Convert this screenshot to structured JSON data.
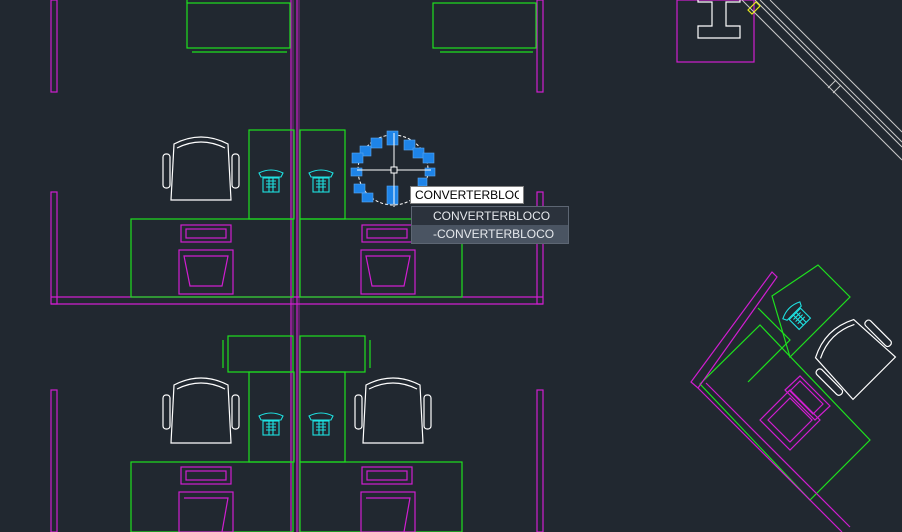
{
  "drawing": {
    "background": "#212830",
    "colors": {
      "partition": "#d01ed0",
      "furniture": "#1ee11e",
      "chair": "#ffffff",
      "phone": "#1ee1e1",
      "grip": "#1e84e8",
      "yellow": "#e8e81e"
    }
  },
  "command": {
    "input_value": "CONVERTERBLOCO",
    "suggestions": [
      "CONVERTERBLOCO",
      "-CONVERTERBLOCO"
    ],
    "active_index": 1
  }
}
